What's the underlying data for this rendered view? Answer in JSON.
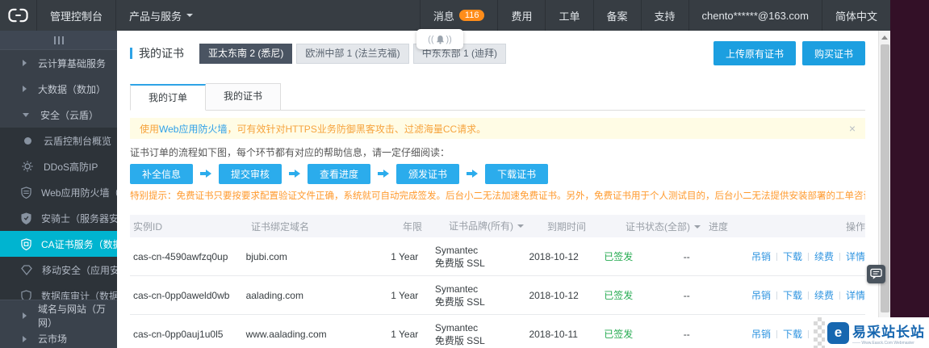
{
  "colors": {
    "navbar_bg": "#373d43",
    "sidebar_bg": "#394049",
    "sidebar_submenu_bg": "#2d3339",
    "sidebar_selected_cyan": "#00b4d0",
    "accent_blue": "#1c9fe0",
    "flow_button_blue": "#2bacec",
    "link_blue": "#2f94e0",
    "status_green": "#27ab52",
    "badge_orange": "#ff8d1a",
    "tip_orange": "#ff9a2e",
    "notice_bg": "#fffce5",
    "right_strip_purple": "#331027"
  },
  "topnav": {
    "console_label": "管理控制台",
    "products_label": "产品与服务",
    "messages_label": "消息",
    "messages_count": "116",
    "billing_label": "费用",
    "tickets_label": "工单",
    "beian_label": "备案",
    "support_label": "支持",
    "account_label": "chento******@163.com",
    "language_label": "简体中文"
  },
  "sidebar": {
    "groups_top": [
      {
        "label": "云计算基础服务"
      },
      {
        "label": "大数据（数加）"
      },
      {
        "label": "安全（云盾）"
      }
    ],
    "security_items": [
      {
        "label": "云盾控制台概览"
      },
      {
        "label": "DDoS高防IP"
      },
      {
        "label": "Web应用防火墙（网..."
      },
      {
        "label": "安骑士（服务器安全）"
      },
      {
        "label": "CA证书服务（数据安..."
      },
      {
        "label": "移动安全（应用安全）"
      },
      {
        "label": "数据库审计（数据安"
      }
    ],
    "groups_bottom": [
      {
        "label": "域名与网站（万网）"
      },
      {
        "label": "云市场"
      }
    ]
  },
  "page": {
    "title": "我的证书",
    "regions": [
      {
        "label": "亚太东南 2 (悉尼)"
      },
      {
        "label": "欧洲中部 1 (法兰克福)"
      },
      {
        "label": "中东东部 1 (迪拜)"
      }
    ],
    "upload_button": "上传原有证书",
    "buy_button": "购买证书",
    "tabs": [
      {
        "label": "我的订单"
      },
      {
        "label": "我的证书"
      }
    ],
    "notice_prefix": "使用",
    "notice_link": "Web应用防火墙",
    "notice_suffix": "，可有效针对HTTPS业务防御黑客攻击、过滤海量CC请求。",
    "notice_close": "×",
    "flow_intro": "证书订单的流程如下图，每个环节都有对应的帮助信息，请一定仔细阅读：",
    "flow_steps": [
      "补全信息",
      "提交审核",
      "查看进度",
      "颁发证书",
      "下载证书"
    ],
    "special_tip": "特别提示：免费证书只要按要求配置验证文件正确，系统就可自动完成签发。后台小二无法加速免费证书。另外，免费证书用于个人测试目的，后台小二无法提供安装部署的工单咨询服务哦！"
  },
  "table": {
    "headers": {
      "id": "实例ID",
      "domain": "证书绑定域名",
      "years": "年限",
      "brand": "证书品牌(所有)",
      "expire": "到期时间",
      "status": "证书状态(全部)",
      "progress": "进度",
      "actions": "操作"
    },
    "rows": [
      {
        "id": "cas-cn-4590awfzq0up",
        "domain": "bjubi.com",
        "years": "1 Year",
        "brand_line1": "Symantec",
        "brand_line2": "免费版 SSL",
        "expire": "2018-10-12",
        "status": "已签发",
        "progress": "--"
      },
      {
        "id": "cas-cn-0pp0aweld0wb",
        "domain": "aalading.com",
        "years": "1 Year",
        "brand_line1": "Symantec",
        "brand_line2": "免费版 SSL",
        "expire": "2018-10-12",
        "status": "已签发",
        "progress": "--"
      },
      {
        "id": "cas-cn-0pp0auj1u0l5",
        "domain": "www.aalading.com",
        "years": "1 Year",
        "brand_line1": "Symantec",
        "brand_line2": "免费版 SSL",
        "expire": "2018-10-11",
        "status": "已签发",
        "progress": "--"
      }
    ],
    "action_labels": [
      "吊销",
      "下载",
      "续费",
      "详情"
    ]
  },
  "misc": {
    "bell_left": "((",
    "bell_right": "))"
  },
  "watermark": {
    "brand": "易采站长站",
    "subtitle": "—— Www.Easck.Com Webmaster"
  }
}
